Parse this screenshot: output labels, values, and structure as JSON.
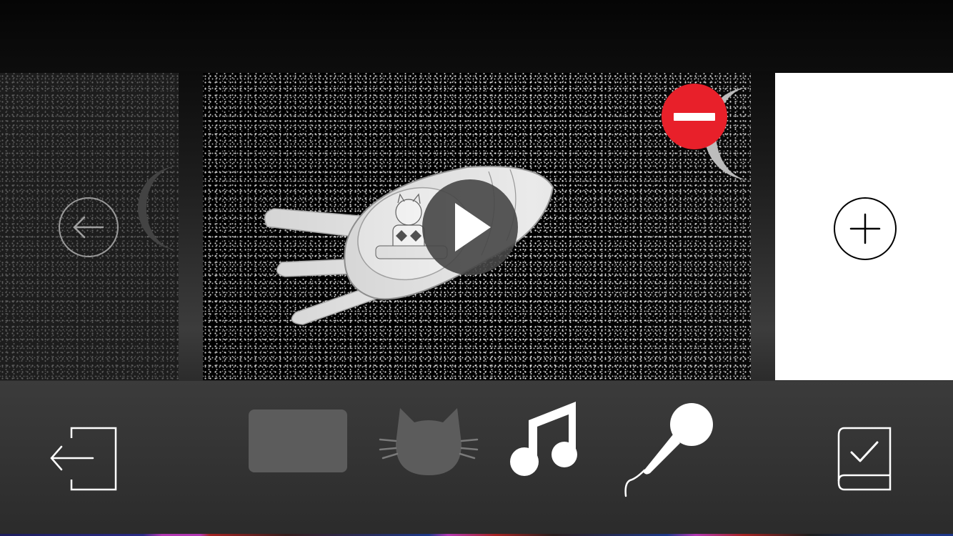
{
  "screen": {
    "title": ""
  },
  "carousel": {
    "previous_page": {
      "back_icon": "arrow-left-circle-icon"
    },
    "current_page": {
      "play_icon": "play-icon",
      "remove_icon": "remove-minus-icon",
      "illustration": "cat-in-rocket-space-illustration"
    },
    "next_page": {
      "add_icon": "plus-circle-icon"
    }
  },
  "toolbar": {
    "items": [
      {
        "name": "exit",
        "icon": "exit-door-arrow-icon",
        "active": true
      },
      {
        "name": "background",
        "icon": "background-card-icon",
        "active": false
      },
      {
        "name": "character",
        "icon": "cat-face-icon",
        "active": false
      },
      {
        "name": "music",
        "icon": "music-note-icon",
        "active": true
      },
      {
        "name": "record",
        "icon": "microphone-icon",
        "active": true
      },
      {
        "name": "finish",
        "icon": "book-check-icon",
        "active": true
      }
    ]
  },
  "colors": {
    "remove": "#e8202a",
    "panel_bg": "#000000",
    "add_panel_bg": "#ffffff",
    "toolbar_bg": "#353535",
    "inactive_tool": "#5c5c5c"
  }
}
